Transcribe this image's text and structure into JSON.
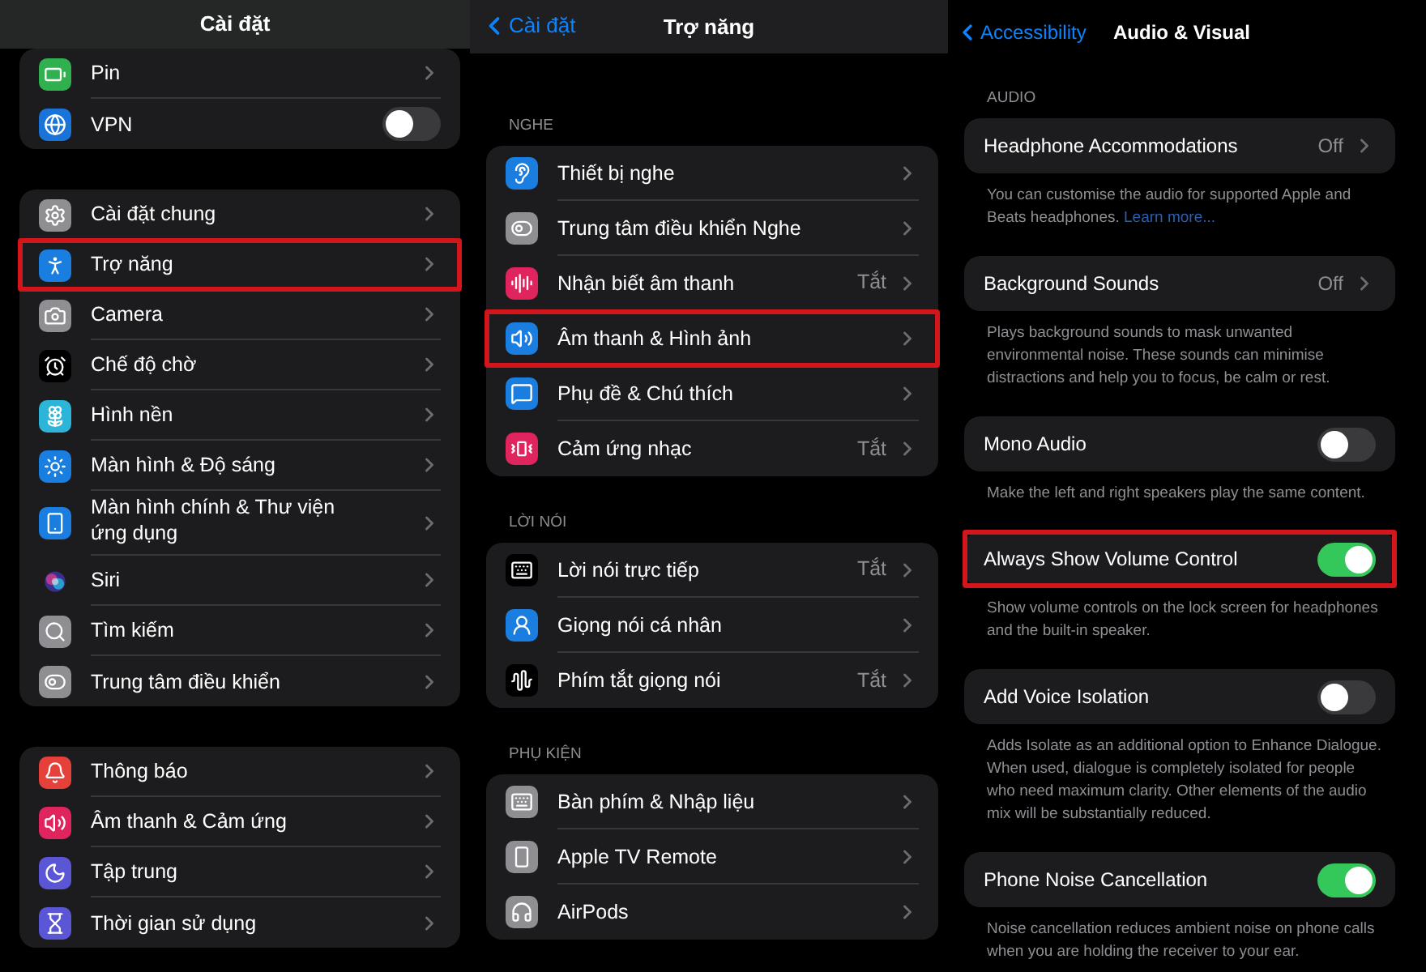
{
  "panels": [
    {
      "header": {
        "title": "Cài đặt"
      },
      "groups": [
        {
          "rows": [
            {
              "label": "Pin",
              "kind": "chevron",
              "color": "#30b04f",
              "highlighted": false
            },
            {
              "label": "VPN",
              "kind": "toggle",
              "on": false,
              "color": "#1a73d9",
              "highlighted": false
            }
          ]
        },
        {
          "rows": [
            {
              "label": "Cài đặt chung",
              "kind": "chevron",
              "color": "#8e8e93",
              "highlighted": false
            },
            {
              "label": "Trợ năng",
              "kind": "chevron",
              "color": "#1a7ee0",
              "highlighted": true
            },
            {
              "label": "Camera",
              "kind": "chevron",
              "color": "#8e8e93",
              "highlighted": false
            },
            {
              "label": "Chế độ chờ",
              "kind": "chevron",
              "color": "#000000",
              "highlighted": false
            },
            {
              "label": "Hình nền",
              "kind": "chevron",
              "color": "#2cb5d8",
              "highlighted": false
            },
            {
              "label": "Màn hình & Độ sáng",
              "kind": "chevron",
              "color": "#1a7ee0",
              "highlighted": false
            },
            {
              "label": "Màn hình chính & Thư viện ứng dụng",
              "kind": "chevron",
              "color": "#1a7ee0",
              "highlighted": false
            },
            {
              "label": "Siri",
              "kind": "chevron",
              "color": "#1c1c1e",
              "highlighted": false
            },
            {
              "label": "Tìm kiếm",
              "kind": "chevron",
              "color": "#8e8e93",
              "highlighted": false
            },
            {
              "label": "Trung tâm điều khiển",
              "kind": "chevron",
              "color": "#8e8e93",
              "highlighted": false
            }
          ]
        },
        {
          "rows": [
            {
              "label": "Thông báo",
              "kind": "chevron",
              "color": "#e5403a",
              "highlighted": false
            },
            {
              "label": "Âm thanh & Cảm ứng",
              "kind": "chevron",
              "color": "#e0245e",
              "highlighted": false
            },
            {
              "label": "Tập trung",
              "kind": "chevron",
              "color": "#5a56d6",
              "highlighted": false
            },
            {
              "label": "Thời gian sử dụng",
              "kind": "chevron",
              "color": "#5a56d6",
              "highlighted": false
            }
          ]
        }
      ]
    },
    {
      "header": {
        "back": "Cài đặt",
        "title": "Trợ năng"
      },
      "groups": [
        {
          "label": "NGHE",
          "rows": [
            {
              "label": "Thiết bị nghe",
              "kind": "chevron",
              "color": "#1a7ee0",
              "highlighted": false
            },
            {
              "label": "Trung tâm điều khiển Nghe",
              "kind": "chevron",
              "color": "#8e8e93",
              "highlighted": false
            },
            {
              "label": "Nhận biết âm thanh",
              "kind": "chevron",
              "value": "Tắt",
              "color": "#e0245e",
              "highlighted": false
            },
            {
              "label": "Âm thanh & Hình ảnh",
              "kind": "chevron",
              "color": "#1a7ee0",
              "highlighted": true
            },
            {
              "label": "Phụ đề & Chú thích",
              "kind": "chevron",
              "color": "#1a7ee0",
              "highlighted": false
            },
            {
              "label": "Cảm ứng nhạc",
              "kind": "chevron",
              "value": "Tắt",
              "color": "#e0245e",
              "highlighted": false
            }
          ]
        },
        {
          "label": "LỜI NÓI",
          "rows": [
            {
              "label": "Lời nói trực tiếp",
              "kind": "chevron",
              "value": "Tắt",
              "color": "#000000",
              "highlighted": false
            },
            {
              "label": "Giọng nói cá nhân",
              "kind": "chevron",
              "color": "#1a7ee0",
              "highlighted": false
            },
            {
              "label": "Phím tắt giọng nói",
              "kind": "chevron",
              "value": "Tắt",
              "color": "#000000",
              "highlighted": false
            }
          ]
        },
        {
          "label": "PHỤ KIỆN",
          "rows": [
            {
              "label": "Bàn phím & Nhập liệu",
              "kind": "chevron",
              "color": "#8e8e93",
              "highlighted": false
            },
            {
              "label": "Apple TV Remote",
              "kind": "chevron",
              "color": "#8e8e93",
              "highlighted": false
            },
            {
              "label": "AirPods",
              "kind": "chevron",
              "color": "#8e8e93",
              "highlighted": false
            }
          ]
        }
      ]
    },
    {
      "header": {
        "back": "Accessibility",
        "title": "Audio & Visual"
      },
      "groups": [
        {
          "label": "AUDIO",
          "rows": [
            {
              "label": "Headphone Accommodations",
              "kind": "chevron",
              "value": "Off",
              "highlighted": false
            }
          ],
          "footer": {
            "text": "You can customise the audio for supported Apple and Beats headphones.",
            "link": "Learn more..."
          }
        },
        {
          "rows": [
            {
              "label": "Background Sounds",
              "kind": "chevron",
              "value": "Off",
              "highlighted": false
            }
          ],
          "footer": {
            "text": "Plays background sounds to mask unwanted environmental noise. These sounds can minimise distractions and help you to focus, be calm or rest."
          }
        },
        {
          "rows": [
            {
              "label": "Mono Audio",
              "kind": "toggle",
              "on": false,
              "highlighted": false
            }
          ],
          "footer": {
            "text": "Make the left and right speakers play the same content."
          }
        },
        {
          "rows": [
            {
              "label": "Always Show Volume Control",
              "kind": "toggle",
              "on": true,
              "highlighted": true
            }
          ],
          "footer": {
            "text": "Show volume controls on the lock screen for headphones and the built-in speaker."
          }
        },
        {
          "rows": [
            {
              "label": "Add Voice Isolation",
              "kind": "toggle",
              "on": false,
              "highlighted": false
            }
          ],
          "footer": {
            "text": "Adds Isolate as an additional option to Enhance Dialogue. When used, dialogue is completely isolated for people who need maximum clarity. Other elements of the audio mix will be substantially reduced."
          }
        },
        {
          "rows": [
            {
              "label": "Phone Noise Cancellation",
              "kind": "toggle",
              "on": true,
              "highlighted": false
            }
          ],
          "footer": {
            "text": "Noise cancellation reduces ambient noise on phone calls when you are holding the receiver to your ear."
          }
        }
      ]
    }
  ]
}
